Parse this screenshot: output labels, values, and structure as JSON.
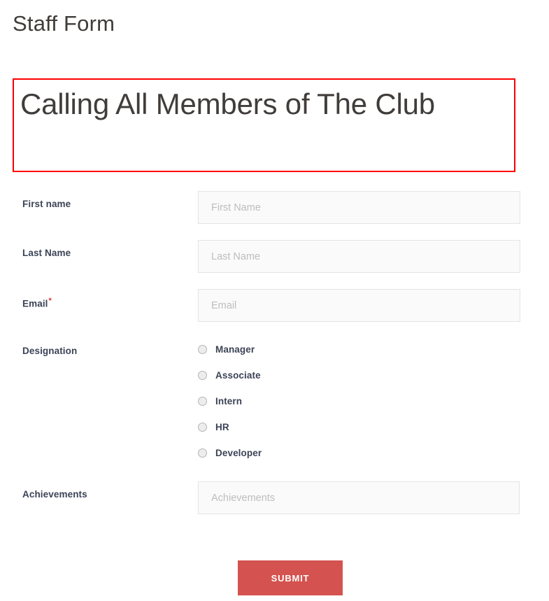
{
  "page": {
    "title": "Staff Form",
    "heading": "Calling All Members of The Club"
  },
  "annotation": {
    "border_color": "#ff0000"
  },
  "form": {
    "fields": [
      {
        "label": "First name",
        "placeholder": "First Name",
        "value": "",
        "required": false,
        "type": "text"
      },
      {
        "label": "Last Name",
        "placeholder": "Last Name",
        "value": "",
        "required": false,
        "type": "text"
      },
      {
        "label": "Email",
        "placeholder": "Email",
        "value": "",
        "required": true,
        "required_marker": "*",
        "type": "text"
      },
      {
        "label": "Designation",
        "type": "radio",
        "options": [
          {
            "label": "Manager",
            "checked": false
          },
          {
            "label": "Associate",
            "checked": false
          },
          {
            "label": "Intern",
            "checked": false
          },
          {
            "label": "HR",
            "checked": false
          },
          {
            "label": "Developer",
            "checked": false
          }
        ]
      },
      {
        "label": "Achievements",
        "placeholder": "Achievements",
        "value": "",
        "required": false,
        "type": "text"
      }
    ],
    "submit_label": "SUBMIT",
    "submit_color": "#d4524f"
  }
}
